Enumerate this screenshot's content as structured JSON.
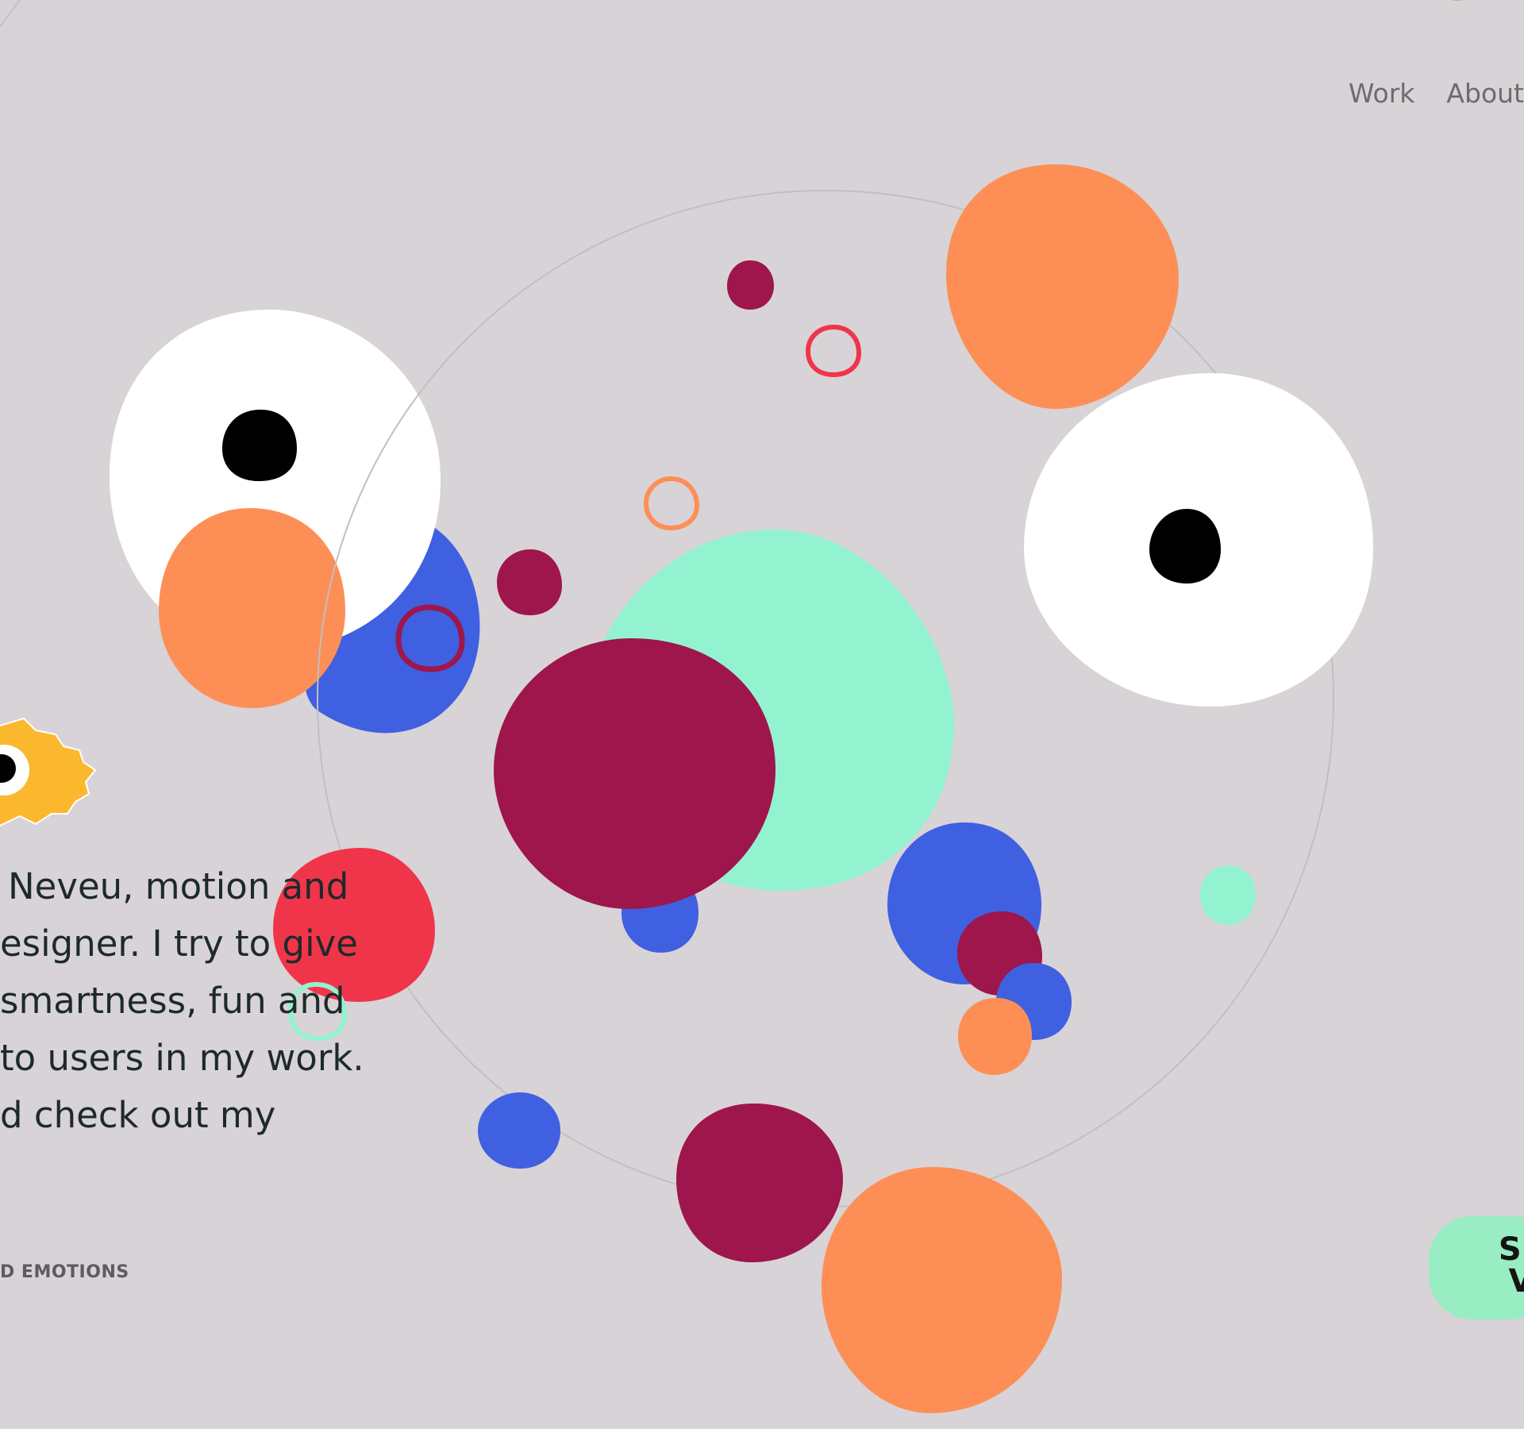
{
  "nav": {
    "work_label": "Work",
    "about_label": "About"
  },
  "intro": {
    "lines": [
      "Neveu, motion and",
      "esigner. I try to give",
      "smartness, fun and",
      "to users in my work.",
      "d check out my"
    ]
  },
  "tagline": "D EMOTIONS",
  "cta": {
    "label": "SE\nV"
  },
  "colors": {
    "background": "#d8d3d7",
    "orange": "#fd8f56",
    "crimson": "#9e164b",
    "blue": "#3f60e0",
    "mint": "#93f3d0",
    "red": "#f0354a",
    "yellow": "#fbb72e",
    "white": "#ffffff",
    "black": "#000000",
    "ring": "#c3bec2"
  }
}
